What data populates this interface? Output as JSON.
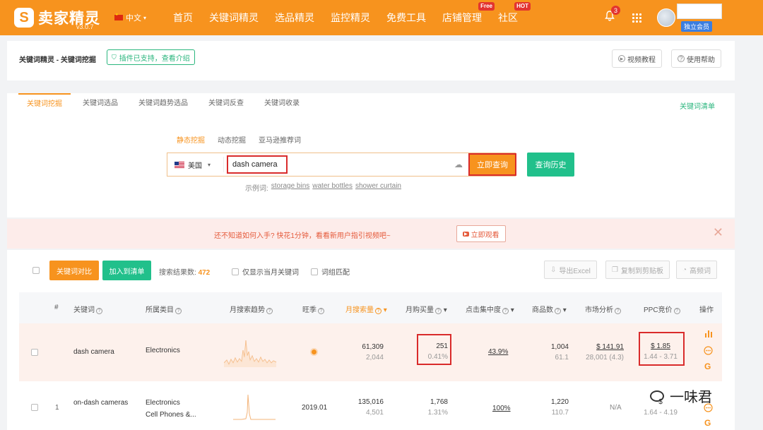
{
  "app": {
    "logo_mark": "S",
    "logo_text": "卖家精灵",
    "version": "v3.0.7",
    "language": "中文"
  },
  "nav": [
    {
      "label": "首页"
    },
    {
      "label": "关键词精灵"
    },
    {
      "label": "选品精灵"
    },
    {
      "label": "监控精灵"
    },
    {
      "label": "免费工具"
    },
    {
      "label": "店铺管理",
      "badge": "Free"
    },
    {
      "label": "社区",
      "badge": "HOT"
    }
  ],
  "user": {
    "notifications": "3",
    "membership": "独立会员"
  },
  "breadcrumb": {
    "path": "关键词精灵 - 关键词挖掘",
    "plugin_tag": "插件已支持，查看介绍",
    "video_tutorial": "视频教程",
    "help": "使用帮助"
  },
  "tabs": [
    {
      "label": "关键词挖掘",
      "active": true
    },
    {
      "label": "关键词选品",
      "active": false
    },
    {
      "label": "关键词趋势选品",
      "active": false
    },
    {
      "label": "关键词反查",
      "active": false
    },
    {
      "label": "关键词收录",
      "active": false
    }
  ],
  "keyword_list_link": "关键词清单",
  "sub_tabs": [
    {
      "label": "静态挖掘",
      "active": true
    },
    {
      "label": "动态挖掘",
      "active": false
    },
    {
      "label": "亚马逊推荐词",
      "active": false
    }
  ],
  "search": {
    "country": "美国",
    "keyword": "dash camera",
    "query_button": "立即查询",
    "history_button": "查询历史",
    "examples_label": "示例词:",
    "examples": [
      "storage bins",
      "water bottles",
      "shower curtain"
    ]
  },
  "notice": {
    "text": "还不知道如何入手? 快花1分钟，看看新用户指引视频吧~",
    "button": "立即观看",
    "play_icon": "▶"
  },
  "toolbar": {
    "compare_button": "关键词对比",
    "add_list_button": "加入到清单",
    "result_label": "搜索结果数:",
    "result_count": "472",
    "opt_month": "仅显示当月关键词",
    "opt_match": "词组匹配",
    "export_excel": "导出Excel",
    "copy_clipboard": "复制到剪贴板",
    "high_freq": "高频词"
  },
  "table": {
    "headers": {
      "index": "#",
      "keyword": "关键词",
      "category": "所属类目",
      "trend": "月搜索趋势",
      "season": "旺季",
      "monthly_search": "月搜索量",
      "monthly_purchase": "月购买量",
      "click_concentration": "点击集中度",
      "product_count": "商品数",
      "market_analysis": "市场分析",
      "ppc_bid": "PPC竞价",
      "actions": "操作"
    },
    "rows": [
      {
        "index": "",
        "keyword": "dash camera",
        "category": "Electronics",
        "category2": "",
        "season": "",
        "search_main": "61,309",
        "search_sub": "2,044",
        "purchase_main": "251",
        "purchase_sub": "0.41%",
        "click": "43.9%",
        "products_main": "1,004",
        "products_sub": "61.1",
        "market_main": "$ 141.91",
        "market_sub": "28,001 (4.3)",
        "ppc_main": "$ 1.85",
        "ppc_sub": "1.44 - 3.71"
      },
      {
        "index": "1",
        "keyword": "on-dash cameras",
        "category": "Electronics",
        "category2": "Cell Phones &...",
        "season": "2019.01",
        "search_main": "135,016",
        "search_sub": "4,501",
        "purchase_main": "1,768",
        "purchase_sub": "1.31%",
        "click": "100%",
        "products_main": "1,220",
        "products_sub": "110.7",
        "market_main": "N/A",
        "market_sub": "",
        "ppc_main": "$",
        "ppc_sub": "1.64 - 4.19"
      }
    ]
  },
  "watermark": "一味君",
  "colors": {
    "brand": "#f7931e",
    "accent_green": "#21c08b",
    "highlight_red": "#d92b2b"
  }
}
